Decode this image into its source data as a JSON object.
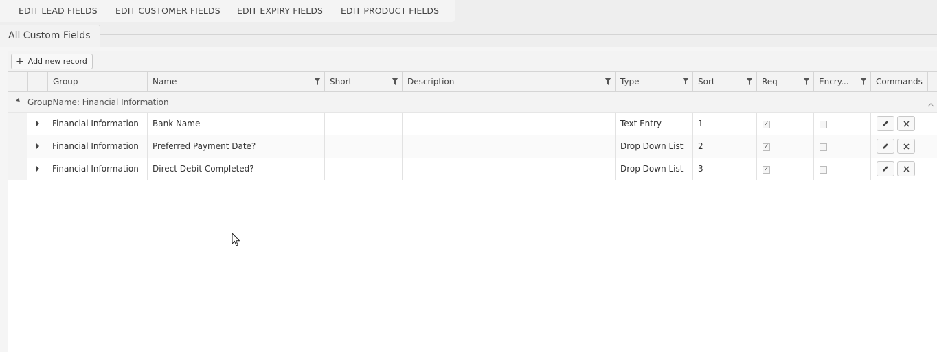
{
  "topnav": {
    "items": [
      "EDIT LEAD FIELDS",
      "EDIT CUSTOMER FIELDS",
      "EDIT EXPIRY FIELDS",
      "EDIT PRODUCT FIELDS"
    ]
  },
  "tab": {
    "label": "All Custom Fields"
  },
  "toolbar": {
    "add_label": "Add new record"
  },
  "columns": [
    "Group",
    "Name",
    "Short",
    "Description",
    "Type",
    "Sort",
    "Req",
    "Encry...",
    "Commands"
  ],
  "group": {
    "label": "GroupName: Financial Information"
  },
  "rows": [
    {
      "group": "Financial Information",
      "name": "Bank Name",
      "short": "",
      "description": "",
      "type": "Text Entry",
      "sort": "1",
      "req": true,
      "encrypted": false
    },
    {
      "group": "Financial Information",
      "name": "Preferred Payment Date?",
      "short": "",
      "description": "",
      "type": "Drop Down List",
      "sort": "2",
      "req": true,
      "encrypted": false
    },
    {
      "group": "Financial Information",
      "name": "Direct Debit Completed?",
      "short": "",
      "description": "",
      "type": "Drop Down List",
      "sort": "3",
      "req": true,
      "encrypted": false
    }
  ],
  "icons": {
    "add": "plus-icon",
    "filter": "filter-icon",
    "expand": "expand-row-icon",
    "edit": "pencil-icon",
    "delete": "close-icon",
    "collapse": "collapse-group-icon",
    "scroll": "chevron-up-icon",
    "cursor": "mouse-cursor-icon"
  }
}
